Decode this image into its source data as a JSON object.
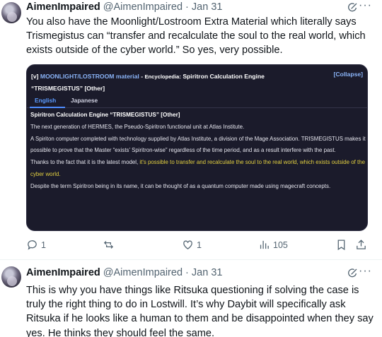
{
  "tweets": [
    {
      "author": {
        "name": "AimenImpaired",
        "handle": "@AimenImpaired"
      },
      "separator": "·",
      "date": "Jan 31",
      "more": "···",
      "text": "You also have the Moonlight/Lostroom Extra Material which literally says Trismegistus can “transfer and recalculate the soul to the real world, which exists outside of the cyber world.” So yes, very possible.",
      "embed": {
        "header_prefix": "[v]",
        "header_title": "MOONLIGHT/LOSTROOM material",
        "header_sep": " - ",
        "header_encyclopedia": "Encyclopedia:",
        "header_entry": " Spiritron Calculation Engine",
        "header_line2": "“TRISMEGISTUS” [Other]",
        "collapse": "[Collapse]",
        "tabs": [
          "English",
          "Japanese"
        ],
        "subtitle": "Spiritron Calculation Engine “TRISMEGISTUS” [Other]",
        "line1": "The next generation of HERMES, the Pseudo-Spiritron functional unit at Atlas Institute.",
        "para2": "A Spiriton computer completed with technology supplied by Atlas Institute, a division of the Mage Association. TRISMEGISTUS makes it possible to prove that the Master “exists’ Spiritron-wise” regardless of the time period, and as a result interfere with the past.",
        "para3_plain": "Thanks to the fact that it is the latest model, ",
        "para3_highlight": "it's possible to transfer and recalculate the soul to the real world, which exists outside of the cyber world.",
        "para4": "Despite the term Spiritron being in its name, it can be thought of as a quantum computer made using magecraft concepts."
      },
      "actions": {
        "replies": "1",
        "reposts": "",
        "likes": "1",
        "views": "105"
      }
    },
    {
      "author": {
        "name": "AimenImpaired",
        "handle": "@AimenImpaired"
      },
      "separator": "·",
      "date": "Jan 31",
      "more": "···",
      "text": "This is why you have things like Ritsuka questioning if solving the case is truly the right thing to do in Lostwill. It’s why Daybit will specifically ask Ritsuka if he looks like a human to them and be disappointed when they say yes. He thinks they should feel the same."
    }
  ],
  "colors": {
    "highlight": "#e3d040",
    "link": "#8ab4f8",
    "embed_bg": "#1b1b2b",
    "muted": "#536471"
  }
}
